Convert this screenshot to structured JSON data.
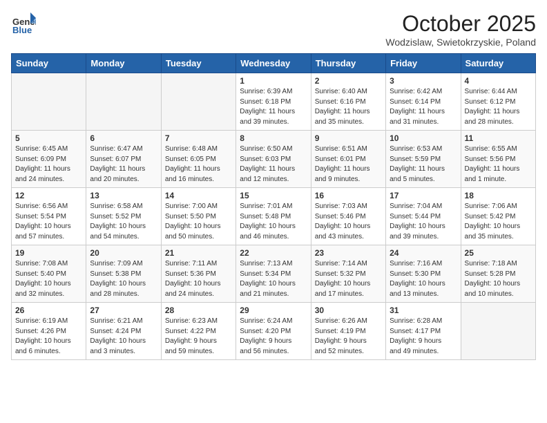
{
  "header": {
    "logo_general": "General",
    "logo_blue": "Blue",
    "month": "October 2025",
    "location": "Wodzislaw, Swietokrzyskie, Poland"
  },
  "weekdays": [
    "Sunday",
    "Monday",
    "Tuesday",
    "Wednesday",
    "Thursday",
    "Friday",
    "Saturday"
  ],
  "weeks": [
    [
      {
        "day": "",
        "info": ""
      },
      {
        "day": "",
        "info": ""
      },
      {
        "day": "",
        "info": ""
      },
      {
        "day": "1",
        "info": "Sunrise: 6:39 AM\nSunset: 6:18 PM\nDaylight: 11 hours\nand 39 minutes."
      },
      {
        "day": "2",
        "info": "Sunrise: 6:40 AM\nSunset: 6:16 PM\nDaylight: 11 hours\nand 35 minutes."
      },
      {
        "day": "3",
        "info": "Sunrise: 6:42 AM\nSunset: 6:14 PM\nDaylight: 11 hours\nand 31 minutes."
      },
      {
        "day": "4",
        "info": "Sunrise: 6:44 AM\nSunset: 6:12 PM\nDaylight: 11 hours\nand 28 minutes."
      }
    ],
    [
      {
        "day": "5",
        "info": "Sunrise: 6:45 AM\nSunset: 6:09 PM\nDaylight: 11 hours\nand 24 minutes."
      },
      {
        "day": "6",
        "info": "Sunrise: 6:47 AM\nSunset: 6:07 PM\nDaylight: 11 hours\nand 20 minutes."
      },
      {
        "day": "7",
        "info": "Sunrise: 6:48 AM\nSunset: 6:05 PM\nDaylight: 11 hours\nand 16 minutes."
      },
      {
        "day": "8",
        "info": "Sunrise: 6:50 AM\nSunset: 6:03 PM\nDaylight: 11 hours\nand 12 minutes."
      },
      {
        "day": "9",
        "info": "Sunrise: 6:51 AM\nSunset: 6:01 PM\nDaylight: 11 hours\nand 9 minutes."
      },
      {
        "day": "10",
        "info": "Sunrise: 6:53 AM\nSunset: 5:59 PM\nDaylight: 11 hours\nand 5 minutes."
      },
      {
        "day": "11",
        "info": "Sunrise: 6:55 AM\nSunset: 5:56 PM\nDaylight: 11 hours\nand 1 minute."
      }
    ],
    [
      {
        "day": "12",
        "info": "Sunrise: 6:56 AM\nSunset: 5:54 PM\nDaylight: 10 hours\nand 57 minutes."
      },
      {
        "day": "13",
        "info": "Sunrise: 6:58 AM\nSunset: 5:52 PM\nDaylight: 10 hours\nand 54 minutes."
      },
      {
        "day": "14",
        "info": "Sunrise: 7:00 AM\nSunset: 5:50 PM\nDaylight: 10 hours\nand 50 minutes."
      },
      {
        "day": "15",
        "info": "Sunrise: 7:01 AM\nSunset: 5:48 PM\nDaylight: 10 hours\nand 46 minutes."
      },
      {
        "day": "16",
        "info": "Sunrise: 7:03 AM\nSunset: 5:46 PM\nDaylight: 10 hours\nand 43 minutes."
      },
      {
        "day": "17",
        "info": "Sunrise: 7:04 AM\nSunset: 5:44 PM\nDaylight: 10 hours\nand 39 minutes."
      },
      {
        "day": "18",
        "info": "Sunrise: 7:06 AM\nSunset: 5:42 PM\nDaylight: 10 hours\nand 35 minutes."
      }
    ],
    [
      {
        "day": "19",
        "info": "Sunrise: 7:08 AM\nSunset: 5:40 PM\nDaylight: 10 hours\nand 32 minutes."
      },
      {
        "day": "20",
        "info": "Sunrise: 7:09 AM\nSunset: 5:38 PM\nDaylight: 10 hours\nand 28 minutes."
      },
      {
        "day": "21",
        "info": "Sunrise: 7:11 AM\nSunset: 5:36 PM\nDaylight: 10 hours\nand 24 minutes."
      },
      {
        "day": "22",
        "info": "Sunrise: 7:13 AM\nSunset: 5:34 PM\nDaylight: 10 hours\nand 21 minutes."
      },
      {
        "day": "23",
        "info": "Sunrise: 7:14 AM\nSunset: 5:32 PM\nDaylight: 10 hours\nand 17 minutes."
      },
      {
        "day": "24",
        "info": "Sunrise: 7:16 AM\nSunset: 5:30 PM\nDaylight: 10 hours\nand 13 minutes."
      },
      {
        "day": "25",
        "info": "Sunrise: 7:18 AM\nSunset: 5:28 PM\nDaylight: 10 hours\nand 10 minutes."
      }
    ],
    [
      {
        "day": "26",
        "info": "Sunrise: 6:19 AM\nSunset: 4:26 PM\nDaylight: 10 hours\nand 6 minutes."
      },
      {
        "day": "27",
        "info": "Sunrise: 6:21 AM\nSunset: 4:24 PM\nDaylight: 10 hours\nand 3 minutes."
      },
      {
        "day": "28",
        "info": "Sunrise: 6:23 AM\nSunset: 4:22 PM\nDaylight: 9 hours\nand 59 minutes."
      },
      {
        "day": "29",
        "info": "Sunrise: 6:24 AM\nSunset: 4:20 PM\nDaylight: 9 hours\nand 56 minutes."
      },
      {
        "day": "30",
        "info": "Sunrise: 6:26 AM\nSunset: 4:19 PM\nDaylight: 9 hours\nand 52 minutes."
      },
      {
        "day": "31",
        "info": "Sunrise: 6:28 AM\nSunset: 4:17 PM\nDaylight: 9 hours\nand 49 minutes."
      },
      {
        "day": "",
        "info": ""
      }
    ]
  ]
}
